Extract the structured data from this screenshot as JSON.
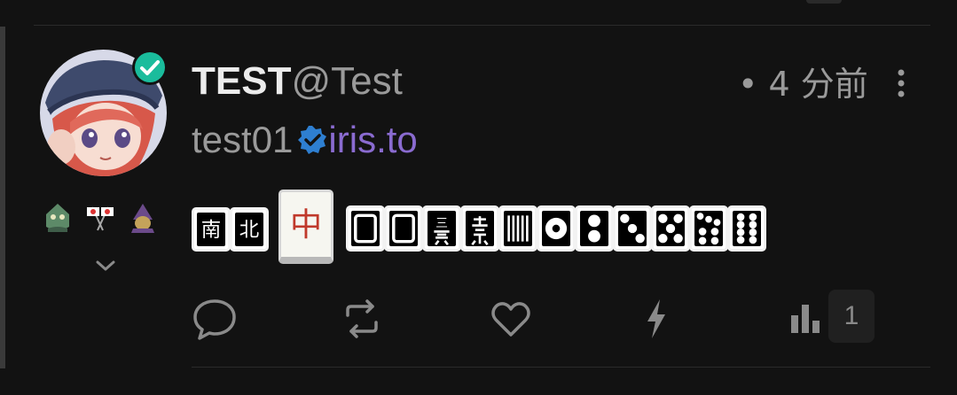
{
  "post": {
    "display_name": "TEST",
    "handle": "@Test",
    "time": "• 4 分前",
    "nip05_user": "test01",
    "nip05_domain": "iris.to"
  },
  "icons": {
    "verified": "verified-check-icon",
    "more": "more-vertical-icon",
    "expand": "chevron-down-icon",
    "reply": "comment-icon",
    "repost": "repost-icon",
    "like": "heart-icon",
    "zap": "lightning-icon",
    "stats": "bar-chart-icon"
  },
  "content": {
    "tile_chars": [
      "南",
      "北",
      "中",
      "三"
    ]
  },
  "stats": {
    "count": "1"
  },
  "colors": {
    "background": "#121212",
    "verified": "#1abc9c",
    "nip05_domain": "#8a6bd0",
    "red_dragon": "#c0392b"
  }
}
